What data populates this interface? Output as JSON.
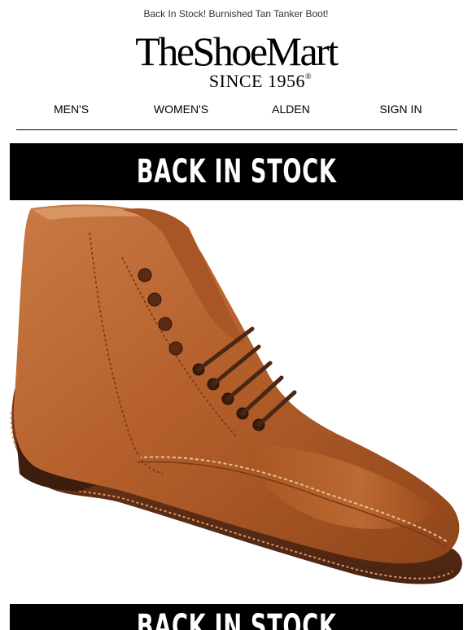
{
  "preheader": "Back In Stock! Burnished Tan Tanker Boot!",
  "logo": {
    "name": "TheShoeMart",
    "since": "SINCE 1956",
    "registered": "®"
  },
  "nav": {
    "mens": "MEN'S",
    "womens": "WOMEN'S",
    "alden": "ALDEN",
    "sign_in": "SIGN IN"
  },
  "banner_top": "BACK IN STOCK",
  "banner_bottom": "BACK IN STOCK",
  "colors": {
    "banner_bg": "#000000",
    "banner_text": "#ffffff",
    "leather": "#b8622e",
    "sole": "#5a2e17"
  },
  "hero_image": "tan-tanker-boot-image"
}
